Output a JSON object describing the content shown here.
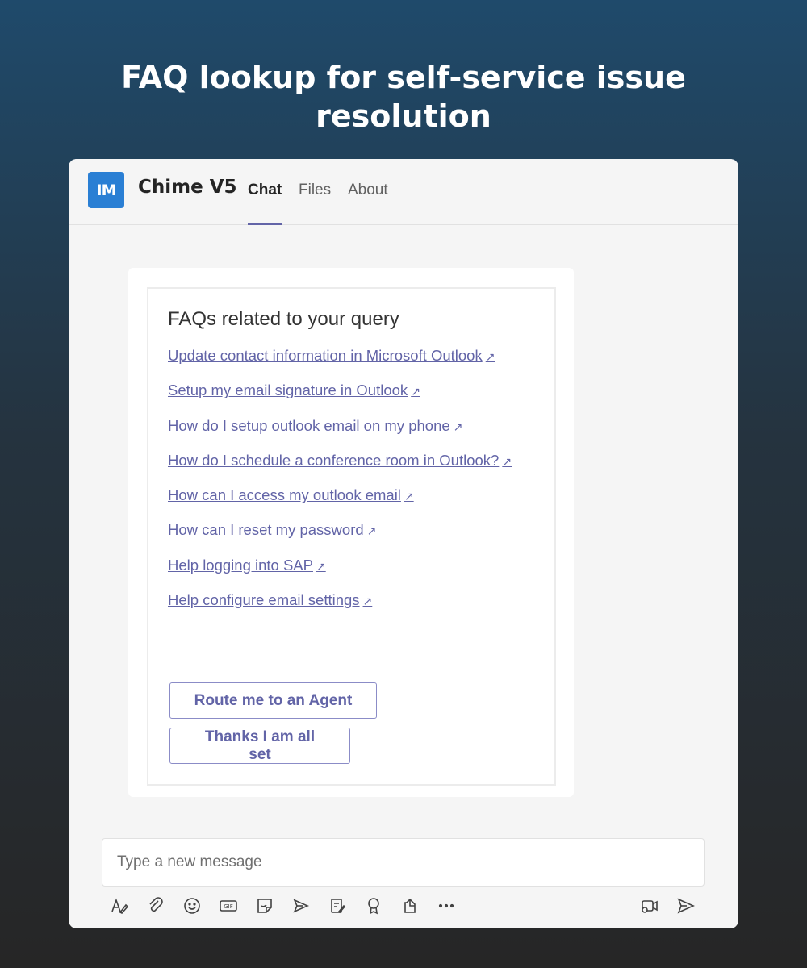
{
  "headline": {
    "line1": "FAQ lookup for self-service issue",
    "line2": "resolution"
  },
  "app": {
    "logo_text": "IM",
    "name": "Chime V5",
    "tabs": [
      {
        "label": "Chat",
        "active": true
      },
      {
        "label": "Files",
        "active": false
      },
      {
        "label": "About",
        "active": false
      }
    ]
  },
  "card": {
    "title": "FAQs related to your query",
    "faqs": [
      "Update contact information in Microsoft Outlook",
      "Setup my email signature in Outlook",
      "How do I setup outlook email on my phone",
      "How do I schedule a conference room in Outlook?",
      "How can I access my outlook email",
      "How can I reset my password",
      "Help logging into SAP",
      "Help configure email settings"
    ],
    "buttons": {
      "route_agent": "Route me to an Agent",
      "all_set": "Thanks I am all set"
    }
  },
  "composer": {
    "placeholder": "Type a new message"
  },
  "toolbar": {
    "icons": [
      "format-icon",
      "attach-icon",
      "emoji-icon",
      "gif-icon",
      "sticker-icon",
      "meet-now-icon",
      "praise-icon",
      "praise-badge-icon",
      "loop-icon",
      "more-options-icon",
      "video-clip-icon",
      "send-icon"
    ]
  },
  "colors": {
    "accent": "#6264a7",
    "logo": "#2a7fd4"
  }
}
